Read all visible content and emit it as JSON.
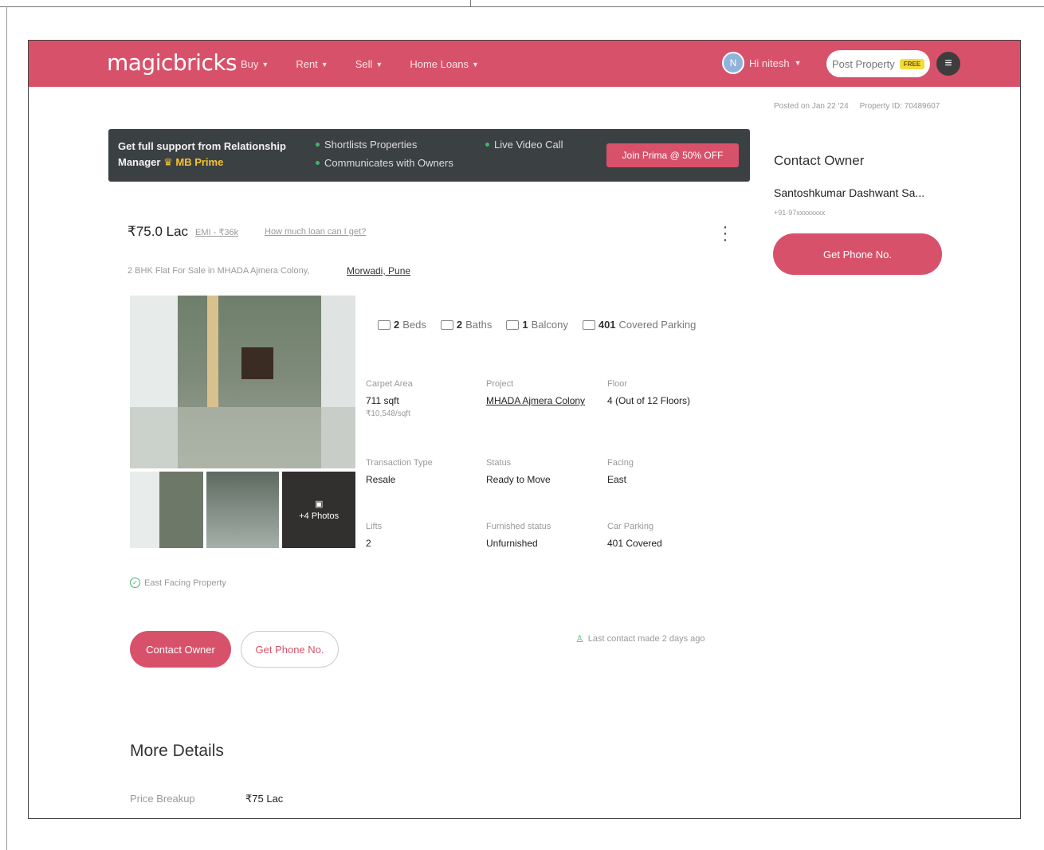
{
  "nav": {
    "logo": "magicbricks",
    "menu": [
      {
        "label": "Buy"
      },
      {
        "label": "Rent"
      },
      {
        "label": "Sell"
      },
      {
        "label": "Home Loans"
      }
    ],
    "user_initial": "N",
    "user_name": "Hi nitesh",
    "post_property": "Post Property",
    "free_badge": "FREE"
  },
  "posted": {
    "date": "Posted on Jan 22 '24",
    "property_id": "Property ID: 70489607"
  },
  "prime_banner": {
    "title_line1": "Get full support from Relationship",
    "title_line2": "Manager",
    "mb_prime": "MB Prime",
    "features": [
      "Shortlists Properties",
      "Communicates with Owners",
      "Live Video Call"
    ],
    "cta": "Join Prima @ 50% OFF"
  },
  "listing": {
    "price": "₹75.0 Lac",
    "emi": "EMI - ₹36k",
    "loan_question": "How much loan can I get?",
    "subtitle": "2 BHK Flat For Sale in MHADA Ajmera Colony,",
    "locality": "Morwadi, Pune",
    "more_photos": "+4 Photos",
    "amenities": [
      {
        "count": "2",
        "label": "Beds"
      },
      {
        "count": "2",
        "label": "Baths"
      },
      {
        "count": "1",
        "label": "Balcony"
      },
      {
        "count": "401",
        "label": "Covered Parking"
      }
    ],
    "specs": {
      "carpet_area": {
        "label": "Carpet Area",
        "value": "711 sqft",
        "sub": "₹10,548/sqft"
      },
      "project": {
        "label": "Project",
        "value": "MHADA Ajmera Colony"
      },
      "floor": {
        "label": "Floor",
        "value": "4 (Out of 12 Floors)"
      },
      "transaction": {
        "label": "Transaction Type",
        "value": "Resale"
      },
      "status": {
        "label": "Status",
        "value": "Ready to Move"
      },
      "facing": {
        "label": "Facing",
        "value": "East"
      },
      "lifts": {
        "label": "Lifts",
        "value": "2"
      },
      "furnished": {
        "label": "Furnished status",
        "value": "Unfurnished"
      },
      "car_parking": {
        "label": "Car Parking",
        "value": "401 Covered"
      }
    },
    "east_facing": "East Facing Property",
    "contact_owner_btn": "Contact Owner",
    "get_phone_btn": "Get Phone No.",
    "last_contact": "Last contact made 2 days ago"
  },
  "more_details": {
    "title": "More Details",
    "price_breakup_label": "Price Breakup",
    "price_breakup_value": "₹75 Lac"
  },
  "contact_owner": {
    "title": "Contact Owner",
    "owner_name": "Santoshkumar Dashwant Sa...",
    "phone_masked": "+91-97xxxxxxxx",
    "get_phone_btn": "Get Phone No."
  },
  "colors": {
    "brand": "#d8516a",
    "banner_bg": "#3b4043",
    "accent_green": "#44b36b"
  }
}
